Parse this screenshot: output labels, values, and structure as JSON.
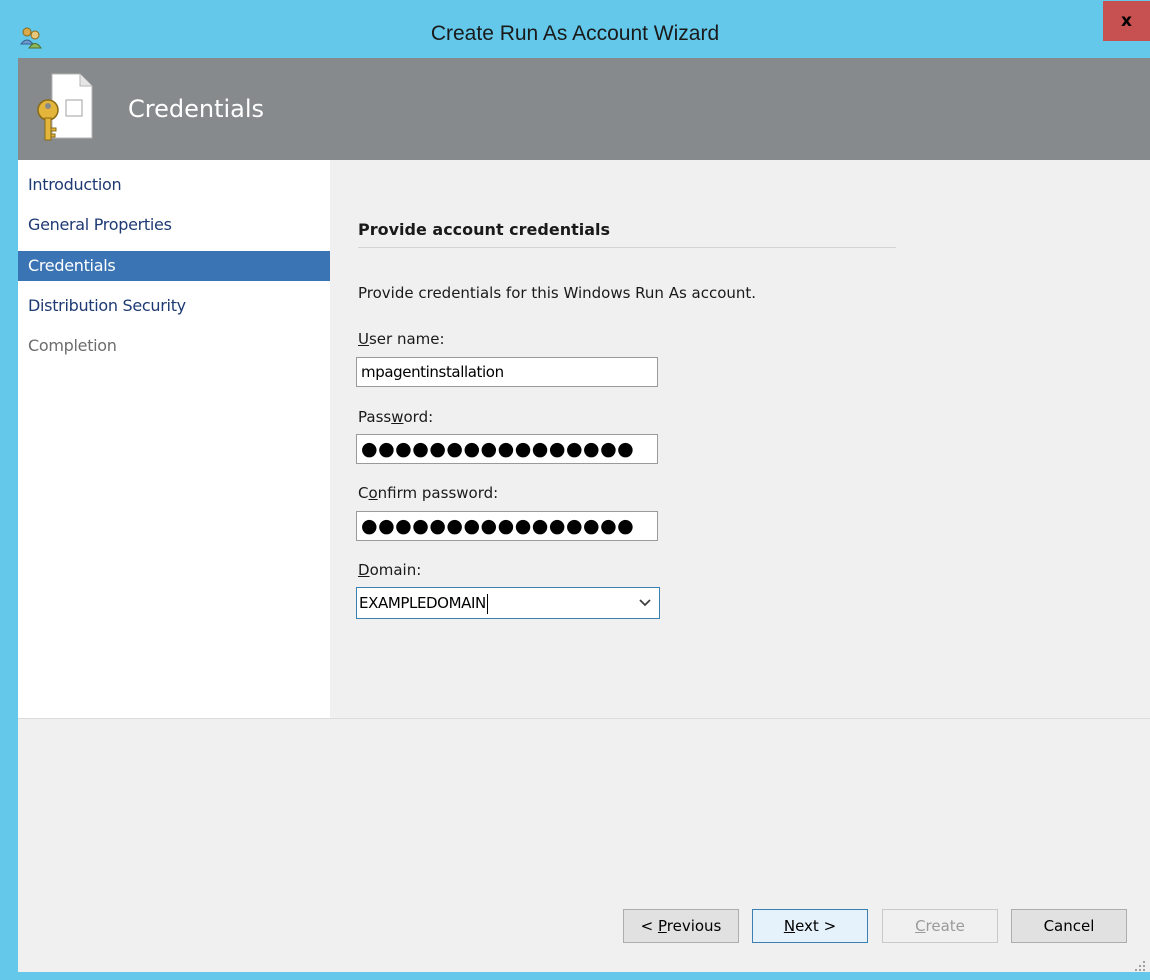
{
  "window": {
    "title": "Create Run As Account Wizard",
    "close_label": "x"
  },
  "header": {
    "title": "Credentials",
    "icon": "key-document-icon"
  },
  "nav": {
    "items": [
      {
        "label": "Introduction",
        "state": "normal"
      },
      {
        "label": "General Properties",
        "state": "normal"
      },
      {
        "label": "Credentials",
        "state": "selected"
      },
      {
        "label": "Distribution Security",
        "state": "normal"
      },
      {
        "label": "Completion",
        "state": "disabled"
      }
    ]
  },
  "main": {
    "section_title": "Provide account credentials",
    "description": "Provide credentials for this Windows Run As account.",
    "username": {
      "label_accel": "U",
      "label_rest": "ser name:",
      "value": "mpagentinstallation"
    },
    "password": {
      "label_pre": "Pass",
      "label_accel": "w",
      "label_post": "ord:",
      "value": "●●●●●●●●●●●●●●●●"
    },
    "confirm": {
      "label_pre": "C",
      "label_accel": "o",
      "label_post": "nfirm password:",
      "value": "●●●●●●●●●●●●●●●●"
    },
    "domain": {
      "label_accel": "D",
      "label_rest": "omain:",
      "value": "EXAMPLEDOMAIN"
    }
  },
  "buttons": {
    "previous": {
      "pre": "< ",
      "accel": "P",
      "post": "revious"
    },
    "next": {
      "accel": "N",
      "post": "ext >"
    },
    "create": {
      "accel": "C",
      "post": "reate"
    },
    "cancel": "Cancel"
  },
  "colors": {
    "titlebar": "#63c8ea",
    "header": "#878a8c",
    "nav_selected": "#3b74b5",
    "close": "#c75050"
  }
}
